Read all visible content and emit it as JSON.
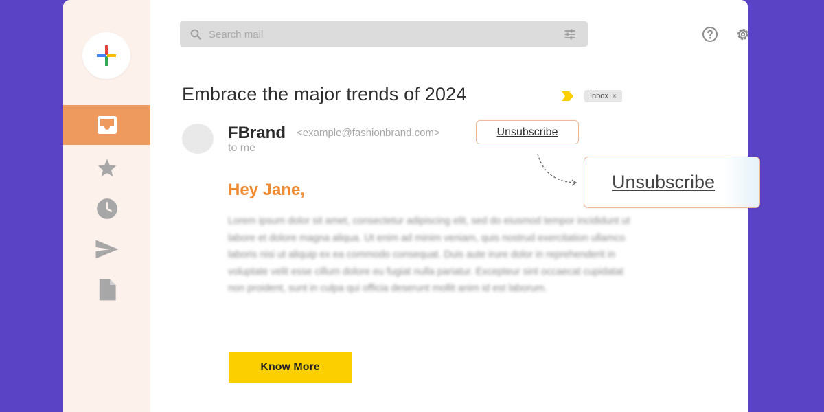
{
  "search": {
    "placeholder": "Search mail"
  },
  "email": {
    "subject": "Embrace the major trends of 2024",
    "label": "Inbox",
    "label_close": "×",
    "sender_name": "FBrand",
    "sender_email": "<example@fashionbrand.com>",
    "recipient": "to me",
    "greeting": "Hey Jane,",
    "body": "Lorem ipsum dolor sit amet, consectetur adipiscing elit, sed do eiusmod tempor incididunt ut labore et dolore magna aliqua. Ut enim ad minim veniam, quis nostrud exercitation ullamco laboris nisi ut aliquip ex ea commodo consequat. Duis aute irure dolor in reprehenderit in voluptate velit esse cillum dolore eu fugiat nulla pariatur. Excepteur sint occaecat cupidatat non proident, sunt in culpa qui officia deserunt mollit anim id est laborum.",
    "cta_label": "Know More",
    "unsubscribe_label": "Unsubscribe"
  },
  "callout": {
    "unsubscribe_label": "Unsubscribe"
  },
  "sidebar": {
    "items": [
      {
        "icon": "inbox-icon",
        "active": true
      },
      {
        "icon": "star-icon",
        "active": false
      },
      {
        "icon": "clock-icon",
        "active": false
      },
      {
        "icon": "send-icon",
        "active": false
      },
      {
        "icon": "document-icon",
        "active": false
      }
    ]
  },
  "colors": {
    "background": "#5b43c6",
    "sidebar": "#fdf1ec",
    "active_nav": "#ee9a5f",
    "greeting": "#f0892f",
    "cta": "#fcd000",
    "accent_border": "#efb894"
  }
}
